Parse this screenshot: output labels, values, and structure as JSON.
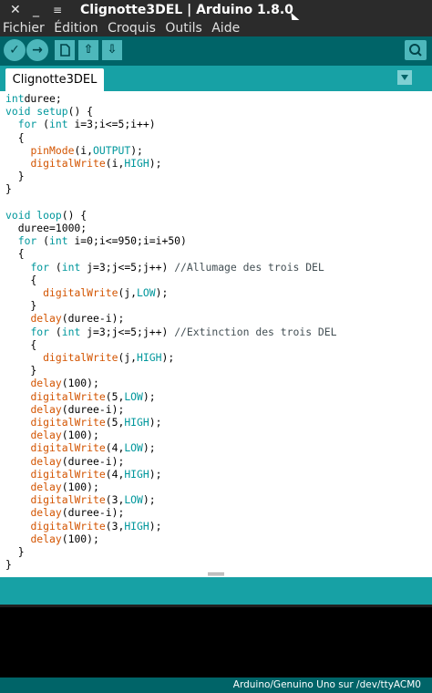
{
  "window": {
    "title": "Clignotte3DEL | Arduino 1.8.0",
    "close_glyph": "✕",
    "minimize_glyph": "_",
    "menu_glyph": "≡"
  },
  "menubar": {
    "items": [
      "Fichier",
      "Édition",
      "Croquis",
      "Outils",
      "Aide"
    ]
  },
  "toolbar": {
    "verify_icon": "checkmark-icon",
    "upload_icon": "arrow-right-icon",
    "new_icon": "new-file-icon",
    "open_icon": "arrow-up-icon",
    "save_icon": "arrow-down-icon",
    "monitor_icon": "magnifier-icon"
  },
  "tabs": [
    {
      "label": "Clignotte3DEL",
      "active": true
    }
  ],
  "colors": {
    "toolbar": "#006468",
    "tabbar": "#17a1a5",
    "keyword": "#00979c",
    "function": "#d35400"
  },
  "code": {
    "lines": [
      [
        [
          "kw",
          "int"
        ],
        [
          "",
          "duree;"
        ]
      ],
      [
        [
          "kw",
          "void"
        ],
        [
          "",
          " "
        ],
        [
          "kw",
          "setup"
        ],
        [
          "",
          "() {"
        ]
      ],
      [
        [
          "",
          "  "
        ],
        [
          "kw",
          "for"
        ],
        [
          "",
          " ("
        ],
        [
          "kw",
          "int"
        ],
        [
          "",
          " i=3;i<=5;i++)"
        ]
      ],
      [
        [
          "",
          "  {"
        ]
      ],
      [
        [
          "",
          "    "
        ],
        [
          "fn",
          "pinMode"
        ],
        [
          "",
          "(i,"
        ],
        [
          "cst",
          "OUTPUT"
        ],
        [
          "",
          ");"
        ]
      ],
      [
        [
          "",
          "    "
        ],
        [
          "fn",
          "digitalWrite"
        ],
        [
          "",
          "(i,"
        ],
        [
          "cst",
          "HIGH"
        ],
        [
          "",
          ");"
        ]
      ],
      [
        [
          "",
          "  }"
        ]
      ],
      [
        [
          "",
          "}"
        ]
      ],
      [
        [
          "",
          ""
        ]
      ],
      [
        [
          "kw",
          "void"
        ],
        [
          "",
          " "
        ],
        [
          "kw",
          "loop"
        ],
        [
          "",
          "() {"
        ]
      ],
      [
        [
          "",
          "  duree=1000;"
        ]
      ],
      [
        [
          "",
          "  "
        ],
        [
          "kw",
          "for"
        ],
        [
          "",
          " ("
        ],
        [
          "kw",
          "int"
        ],
        [
          "",
          " i=0;i<=950;i=i+50)"
        ]
      ],
      [
        [
          "",
          "  {"
        ]
      ],
      [
        [
          "",
          "    "
        ],
        [
          "kw",
          "for"
        ],
        [
          "",
          " ("
        ],
        [
          "kw",
          "int"
        ],
        [
          "",
          " j=3;j<=5;j++) "
        ],
        [
          "cm",
          "//Allumage des trois DEL"
        ]
      ],
      [
        [
          "",
          "    {"
        ]
      ],
      [
        [
          "",
          "      "
        ],
        [
          "fn",
          "digitalWrite"
        ],
        [
          "",
          "(j,"
        ],
        [
          "cst",
          "LOW"
        ],
        [
          "",
          ");"
        ]
      ],
      [
        [
          "",
          "    }"
        ]
      ],
      [
        [
          "",
          "    "
        ],
        [
          "fn",
          "delay"
        ],
        [
          "",
          "(duree-i);"
        ]
      ],
      [
        [
          "",
          "    "
        ],
        [
          "kw",
          "for"
        ],
        [
          "",
          " ("
        ],
        [
          "kw",
          "int"
        ],
        [
          "",
          " j=3;j<=5;j++) "
        ],
        [
          "cm",
          "//Extinction des trois DEL"
        ]
      ],
      [
        [
          "",
          "    {"
        ]
      ],
      [
        [
          "",
          "      "
        ],
        [
          "fn",
          "digitalWrite"
        ],
        [
          "",
          "(j,"
        ],
        [
          "cst",
          "HIGH"
        ],
        [
          "",
          ");"
        ]
      ],
      [
        [
          "",
          "    }"
        ]
      ],
      [
        [
          "",
          "    "
        ],
        [
          "fn",
          "delay"
        ],
        [
          "",
          "(100);"
        ]
      ],
      [
        [
          "",
          "    "
        ],
        [
          "fn",
          "digitalWrite"
        ],
        [
          "",
          "(5,"
        ],
        [
          "cst",
          "LOW"
        ],
        [
          "",
          ");"
        ]
      ],
      [
        [
          "",
          "    "
        ],
        [
          "fn",
          "delay"
        ],
        [
          "",
          "(duree-i);"
        ]
      ],
      [
        [
          "",
          "    "
        ],
        [
          "fn",
          "digitalWrite"
        ],
        [
          "",
          "(5,"
        ],
        [
          "cst",
          "HIGH"
        ],
        [
          "",
          ");"
        ]
      ],
      [
        [
          "",
          "    "
        ],
        [
          "fn",
          "delay"
        ],
        [
          "",
          "(100);"
        ]
      ],
      [
        [
          "",
          "    "
        ],
        [
          "fn",
          "digitalWrite"
        ],
        [
          "",
          "(4,"
        ],
        [
          "cst",
          "LOW"
        ],
        [
          "",
          ");"
        ]
      ],
      [
        [
          "",
          "    "
        ],
        [
          "fn",
          "delay"
        ],
        [
          "",
          "(duree-i);"
        ]
      ],
      [
        [
          "",
          "    "
        ],
        [
          "fn",
          "digitalWrite"
        ],
        [
          "",
          "(4,"
        ],
        [
          "cst",
          "HIGH"
        ],
        [
          "",
          ");"
        ]
      ],
      [
        [
          "",
          "    "
        ],
        [
          "fn",
          "delay"
        ],
        [
          "",
          "(100);"
        ]
      ],
      [
        [
          "",
          "    "
        ],
        [
          "fn",
          "digitalWrite"
        ],
        [
          "",
          "(3,"
        ],
        [
          "cst",
          "LOW"
        ],
        [
          "",
          ");"
        ]
      ],
      [
        [
          "",
          "    "
        ],
        [
          "fn",
          "delay"
        ],
        [
          "",
          "(duree-i);"
        ]
      ],
      [
        [
          "",
          "    "
        ],
        [
          "fn",
          "digitalWrite"
        ],
        [
          "",
          "(3,"
        ],
        [
          "cst",
          "HIGH"
        ],
        [
          "",
          ");"
        ]
      ],
      [
        [
          "",
          "    "
        ],
        [
          "fn",
          "delay"
        ],
        [
          "",
          "(100);"
        ]
      ],
      [
        [
          "",
          "  }"
        ]
      ],
      [
        [
          "",
          "}"
        ]
      ]
    ]
  },
  "status": {
    "board": "Arduino/Genuino Uno sur /dev/ttyACM0"
  }
}
